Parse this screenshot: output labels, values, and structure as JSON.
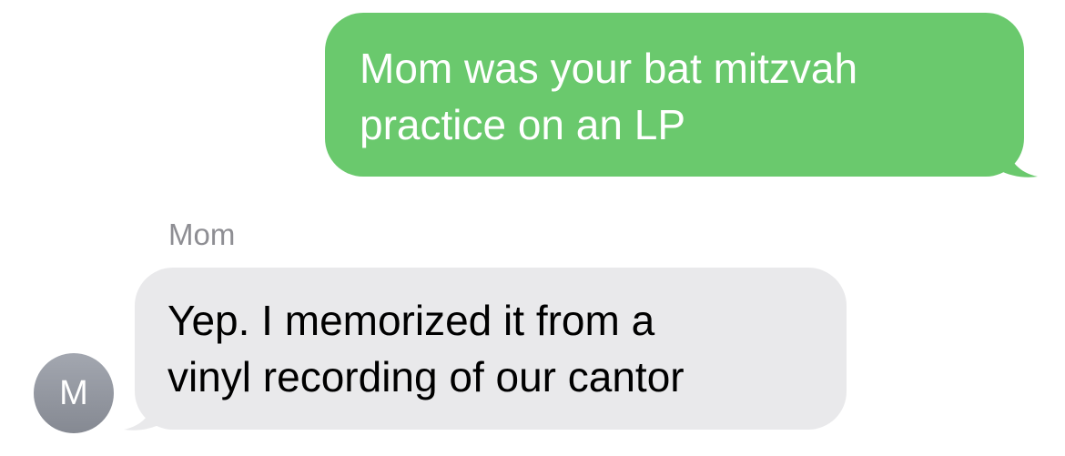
{
  "conversation": {
    "outgoing_message": {
      "lines": [
        "Mom was your bat mitzvah",
        "practice on an LP"
      ],
      "color": "#6ac96d"
    },
    "incoming_message": {
      "sender_name": "Mom",
      "lines": [
        "Yep. I memorized it from a",
        "vinyl recording of our cantor"
      ],
      "avatar_initial": "M",
      "color": "#e9e9eb"
    }
  }
}
